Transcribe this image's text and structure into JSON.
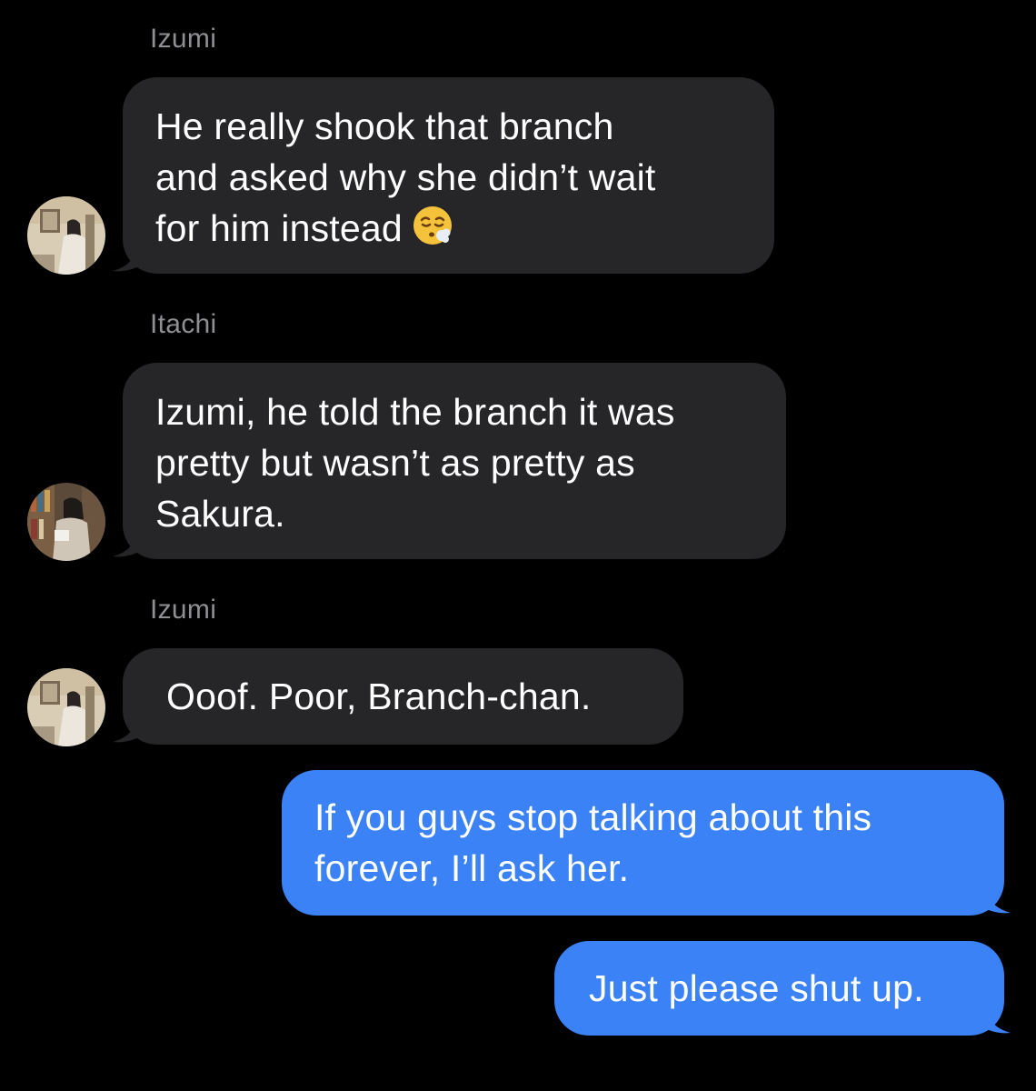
{
  "conversation": {
    "messages": [
      {
        "sender": "Izumi",
        "direction": "incoming",
        "avatar": "izumi-photo",
        "lines": [
          "He really shook that branch",
          "and asked why she didn’t wait",
          "for him instead"
        ],
        "emoji": "😮‍💨"
      },
      {
        "sender": "Itachi",
        "direction": "incoming",
        "avatar": "itachi-photo",
        "lines": [
          "Izumi, he told the branch it was",
          "pretty but wasn’t as pretty as",
          "Sakura."
        ]
      },
      {
        "sender": "Izumi",
        "direction": "incoming",
        "avatar": "izumi-photo",
        "lines": [
          "Ooof. Poor, Branch-chan."
        ]
      },
      {
        "direction": "outgoing",
        "lines": [
          "If you guys stop talking about this",
          "forever, I’ll ask her."
        ]
      },
      {
        "direction": "outgoing",
        "lines": [
          "Just please shut up."
        ]
      }
    ]
  },
  "colors": {
    "background": "#000000",
    "incoming_bubble": "#262629",
    "outgoing_bubble": "#3b82f6",
    "sender_label": "#8e8e93"
  }
}
